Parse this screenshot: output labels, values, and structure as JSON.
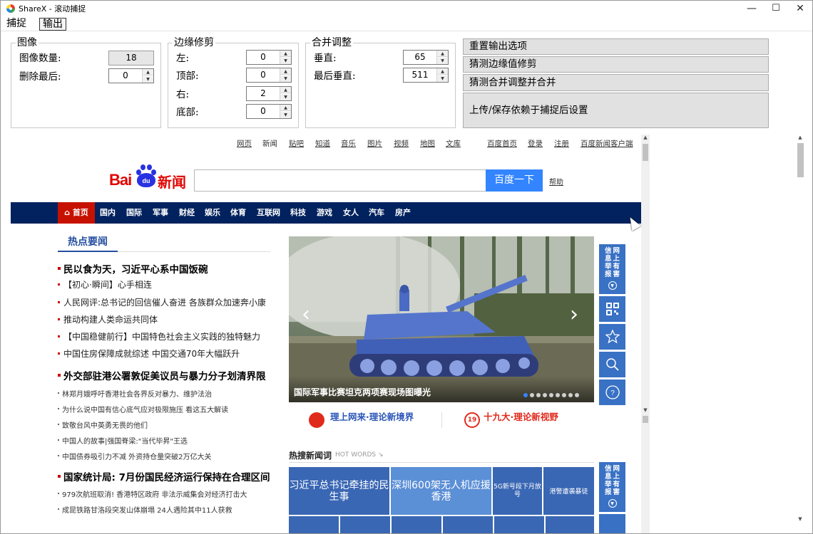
{
  "window": {
    "title": "ShareX - 滚动捕捉",
    "minimize": "—",
    "maximize": "☐",
    "close": "✕"
  },
  "menu": {
    "capture": "捕捉",
    "output": "输出"
  },
  "image_group": {
    "title": "图像",
    "count_label": "图像数量:",
    "count_value": "18",
    "remove_last_label": "删除最后:",
    "remove_last_value": "0"
  },
  "trim_group": {
    "title": "边缘修剪",
    "left_label": "左:",
    "left_value": "0",
    "top_label": "顶部:",
    "top_value": "0",
    "right_label": "右:",
    "right_value": "2",
    "bottom_label": "底部:",
    "bottom_value": "0"
  },
  "merge_group": {
    "title": "合并调整",
    "vertical_label": "垂直:",
    "vertical_value": "65",
    "last_vertical_label": "最后垂直:",
    "last_vertical_value": "511"
  },
  "actions": {
    "reset": "重置输出选项",
    "guess_trim": "猜测边缘值修剪",
    "guess_merge": "猜测合并调整并合并",
    "upload": "上传/保存依赖于捕捉后设置"
  },
  "baidu": {
    "top_links": [
      "网页",
      "新闻",
      "贴吧",
      "知道",
      "音乐",
      "图片",
      "视频",
      "地图",
      "文库",
      "百度首页",
      "登录",
      "注册",
      "百度新闻客户端"
    ],
    "logo_text": "Bai",
    "logo_paw_text": "du",
    "logo_news": "新闻",
    "search_button": "百度一下",
    "help": "帮助",
    "nav": [
      "首页",
      "国内",
      "国际",
      "军事",
      "财经",
      "娱乐",
      "体育",
      "互联网",
      "科技",
      "游戏",
      "女人",
      "汽车",
      "房产"
    ],
    "hot_title": "热点要闻",
    "headlines": [
      {
        "text": "民以食为天，习近平心系中国饭碗",
        "style": "big"
      },
      {
        "text": "【初心·瞬间】心手相连",
        "style": "mid"
      },
      {
        "text": "人民网评:总书记的回信催人奋进 各族群众加速奔小康",
        "style": "mid"
      },
      {
        "text": "推动构建人类命运共同体",
        "style": "mid"
      },
      {
        "text": "【中国稳健前行】中国特色社会主义实践的独特魅力",
        "style": "mid"
      },
      {
        "text": "中国住房保障成就综述  中国交通70年大幅跃升",
        "style": "mid"
      },
      {
        "text": "外交部驻港公署敦促美议员与暴力分子划清界限",
        "style": "big"
      },
      {
        "text": "林郑月娥呼吁香港社会各界反对暴力、维护法治",
        "style": "sm"
      },
      {
        "text": "为什么说中国有信心底气应对极限施压 看这五大解读",
        "style": "sm"
      },
      {
        "text": "致敬台风中英勇无畏的他们",
        "style": "sm"
      },
      {
        "text": "中国人的故事|强国脊梁:\"当代毕昇\"王选",
        "style": "sm"
      },
      {
        "text": "中国债券吸引力不减 外资持仓量突破2万亿大关",
        "style": "sm"
      },
      {
        "text": "国家统计局: 7月份国民经济运行保持在合理区间",
        "style": "big"
      },
      {
        "text": "979次航班取消! 香港特区政府 非法示威集会对经济打击大",
        "style": "sm"
      },
      {
        "text": "成昆铁路甘洛段突发山体崩塌 24人遇险其中11人获救",
        "style": "sm"
      }
    ],
    "slide_caption": "国际军事比赛坦克两项赛现场图曝光",
    "slide_prev": "‹",
    "slide_next": "›",
    "side_report": "网上有害信息举报",
    "banner_left": "理上网来·理论新境界",
    "banner_right": "十九大·理论新视野",
    "banner_right_icon": "19",
    "hotwords_title": "热搜新闻词",
    "hotwords_sub": "HOT WORDS ↘",
    "hotwords": [
      "习近平总书记牵挂的民生事",
      "深圳600架无人机应援香港",
      "5G新号段下月放号",
      "港警遭袭暴徒"
    ]
  },
  "colors": {
    "baidu_red": "#e10602",
    "baidu_blue": "#3385ff",
    "nav_bg": "#01225e",
    "nav_home": "#c71100",
    "side_blue": "#3971c4",
    "tile_dark": "#3a67b4",
    "tile_light": "#5b8fd6"
  }
}
